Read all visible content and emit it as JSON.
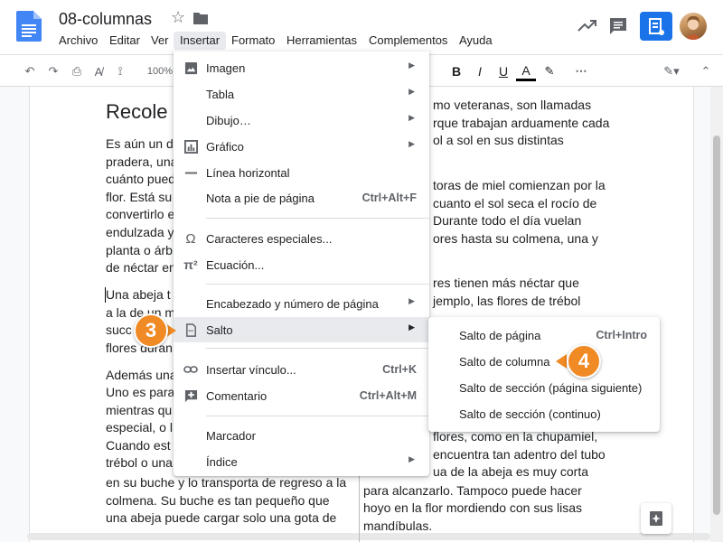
{
  "doc": {
    "title": "08-columnas"
  },
  "menubar": [
    "Archivo",
    "Editar",
    "Ver",
    "Insertar",
    "Formato",
    "Herramientas",
    "Complementos",
    "Ayuda"
  ],
  "toolbar": {
    "zoom": "100%"
  },
  "left_column": [
    "Recole",
    "Es aún un d",
    "pradera, una",
    "cuánto pued",
    "flor. Está su",
    "convertirlo e",
    "endulzada y",
    "planta o árb",
    "de néctar en",
    "Una abeja t",
    "a la de un m",
    "succ",
    "flores duran",
    "Además una",
    "Uno es para",
    "mientras qu",
    "especial, o l",
    "Cuando est",
    "trébol o una",
    "en su buche y lo transporta de regreso a la",
    "colmena. Su buche es tan pequeño que",
    "una abeja puede cargar solo una gota de"
  ],
  "right_column": [
    "mo veteranas, son llamadas",
    "rque trabajan arduamente cada",
    "ol a sol en sus distintas",
    "toras de miel comienzan por la",
    "cuanto el sol seca el rocío de",
    "Durante todo el día vuelan",
    "ores hasta su colmena, una y",
    "res tienen más néctar que",
    "jemplo, las flores de trébol",
    "flores, como en la chupamiel,",
    "encuentra tan adentro del tubo",
    "ua de la abeja es muy corta",
    "para alcanzarlo. Tampoco puede hacer",
    "hoyo en la flor mordiendo con sus lisas",
    "mandíbulas."
  ],
  "insert_menu": {
    "items": [
      {
        "label": "Imagen",
        "icon": "image-icon"
      },
      {
        "label": "Tabla",
        "icon": ""
      },
      {
        "label": "Dibujo…",
        "icon": ""
      },
      {
        "label": "Gráfico",
        "icon": "chart-icon"
      },
      {
        "label": "Línea horizontal",
        "icon": "horizontal-line-icon"
      },
      {
        "label": "Nota a pie de página",
        "shortcut": "Ctrl+Alt+F"
      },
      {
        "label": "Caracteres especiales...",
        "icon": "omega-icon"
      },
      {
        "label": "Ecuación...",
        "icon": "pi-icon"
      },
      {
        "label": "Encabezado y número de página"
      },
      {
        "label": "Salto",
        "icon": "page-break-icon"
      },
      {
        "label": "Insertar vínculo...",
        "icon": "link-icon",
        "shortcut": "Ctrl+K"
      },
      {
        "label": "Comentario",
        "icon": "add-comment-icon",
        "shortcut": "Ctrl+Alt+M"
      },
      {
        "label": "Marcador"
      },
      {
        "label": "Índice"
      }
    ]
  },
  "break_submenu": {
    "items": [
      {
        "label": "Salto de página",
        "shortcut": "Ctrl+Intro"
      },
      {
        "label": "Salto de columna"
      },
      {
        "label": "Salto de sección (página siguiente)"
      },
      {
        "label": "Salto de sección (continuo)"
      }
    ]
  },
  "callouts": [
    "3",
    "4"
  ]
}
